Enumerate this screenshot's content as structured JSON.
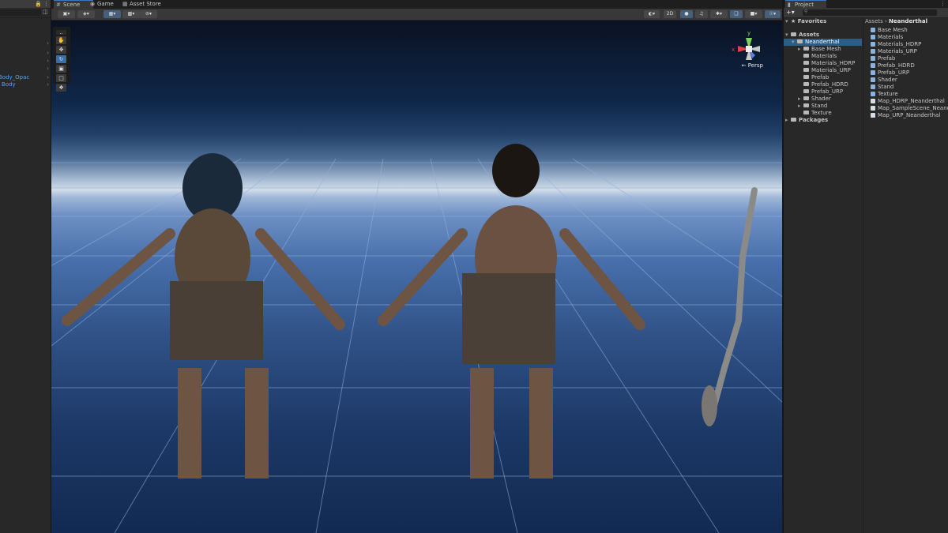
{
  "hierarchy": {
    "items": [
      {
        "label": "Body_Opac"
      },
      {
        "label": "Body"
      }
    ]
  },
  "scene": {
    "tabs": [
      {
        "label": "Scene",
        "icon": "hash-icon"
      },
      {
        "label": "Game",
        "icon": "gamepad-icon"
      },
      {
        "label": "Asset Store",
        "icon": "bag-icon"
      }
    ],
    "toolbar": {
      "mode_2d": "2D"
    },
    "gizmo": {
      "y_label": "y",
      "x_label": "x",
      "projection": "← Persp"
    }
  },
  "project": {
    "tab_label": "Project",
    "favorites_label": "Favorites",
    "assets_label": "Assets",
    "packages_label": "Packages",
    "tree": [
      {
        "label": "Neanderthal",
        "selected": true,
        "expanded": true
      },
      {
        "label": "Base Mesh"
      },
      {
        "label": "Materials"
      },
      {
        "label": "Materials_HDRP"
      },
      {
        "label": "Materials_URP"
      },
      {
        "label": "Prefab"
      },
      {
        "label": "Prefab_HDRD"
      },
      {
        "label": "Prefab_URP"
      },
      {
        "label": "Shader"
      },
      {
        "label": "Stand"
      },
      {
        "label": "Texture"
      }
    ],
    "breadcrumb": {
      "root": "Assets",
      "separator": " › ",
      "current": "Neanderthal"
    },
    "files": [
      {
        "label": "Base Mesh",
        "kind": "folder"
      },
      {
        "label": "Materials",
        "kind": "folder"
      },
      {
        "label": "Materials_HDRP",
        "kind": "folder"
      },
      {
        "label": "Materials_URP",
        "kind": "folder"
      },
      {
        "label": "Prefab",
        "kind": "folder"
      },
      {
        "label": "Prefab_HDRD",
        "kind": "folder"
      },
      {
        "label": "Prefab_URP",
        "kind": "folder"
      },
      {
        "label": "Shader",
        "kind": "folder"
      },
      {
        "label": "Stand",
        "kind": "folder"
      },
      {
        "label": "Texture",
        "kind": "folder"
      },
      {
        "label": "Map_HDRP_Neanderthal",
        "kind": "map"
      },
      {
        "label": "Map_SampleScene_Neanderthal",
        "kind": "map"
      },
      {
        "label": "Map_URP_Neanderthal",
        "kind": "map"
      }
    ]
  },
  "colors": {
    "accent": "#3a79bb",
    "selection": "#2c5d87",
    "panel": "#282828",
    "link": "#5aa0f0"
  }
}
